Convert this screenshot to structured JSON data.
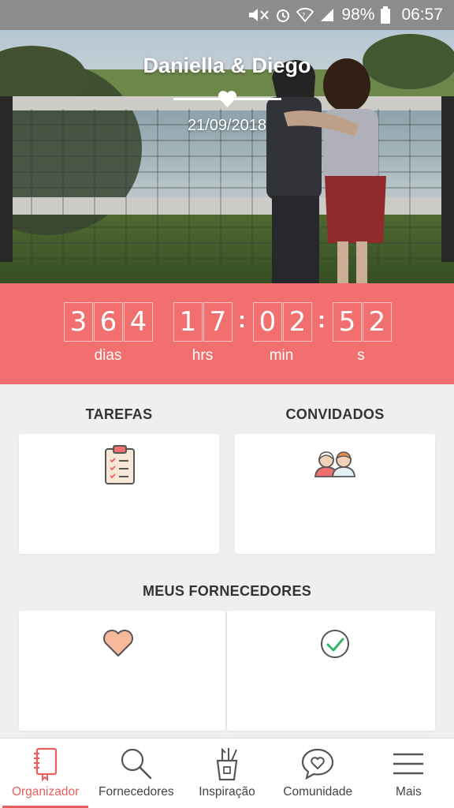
{
  "colors": {
    "accent": "#f26f6f",
    "active_nav": "#e85f5f",
    "status_bar": "#8c8c8c",
    "background": "#efefef"
  },
  "status_bar": {
    "battery": "98%",
    "time": "06:57",
    "icons": [
      "mute-icon",
      "alarm-icon",
      "wifi-icon",
      "signal-icon",
      "battery-icon"
    ]
  },
  "hero": {
    "couple": "Daniella & Diego",
    "date": "21/09/2018",
    "divider_icon": "heart-icon"
  },
  "countdown": {
    "days_digits": [
      "3",
      "6",
      "4"
    ],
    "hours_digits": [
      "1",
      "7"
    ],
    "minutes_digits": [
      "0",
      "2"
    ],
    "seconds_digits": [
      "5",
      "2"
    ],
    "days_label": "dias",
    "hours_label": "hrs",
    "minutes_label": "min",
    "seconds_label": "s"
  },
  "sections": {
    "tasks_title": "TAREFAS",
    "guests_title": "CONVIDADOS",
    "vendors_title": "MEUS FORNECEDORES",
    "tasks_icon": "clipboard-checklist-icon",
    "guests_icon": "couple-avatars-icon",
    "vendors_left_icon": "heart-icon",
    "vendors_right_icon": "check-circle-icon"
  },
  "bottom_nav": [
    {
      "label": "Organizador",
      "icon": "notebook-icon",
      "active": true
    },
    {
      "label": "Fornecedores",
      "icon": "search-icon",
      "active": false
    },
    {
      "label": "Inspiração",
      "icon": "brush-cup-icon",
      "active": false
    },
    {
      "label": "Comunidade",
      "icon": "chat-heart-icon",
      "active": false
    },
    {
      "label": "Mais",
      "icon": "menu-icon",
      "active": false
    }
  ]
}
